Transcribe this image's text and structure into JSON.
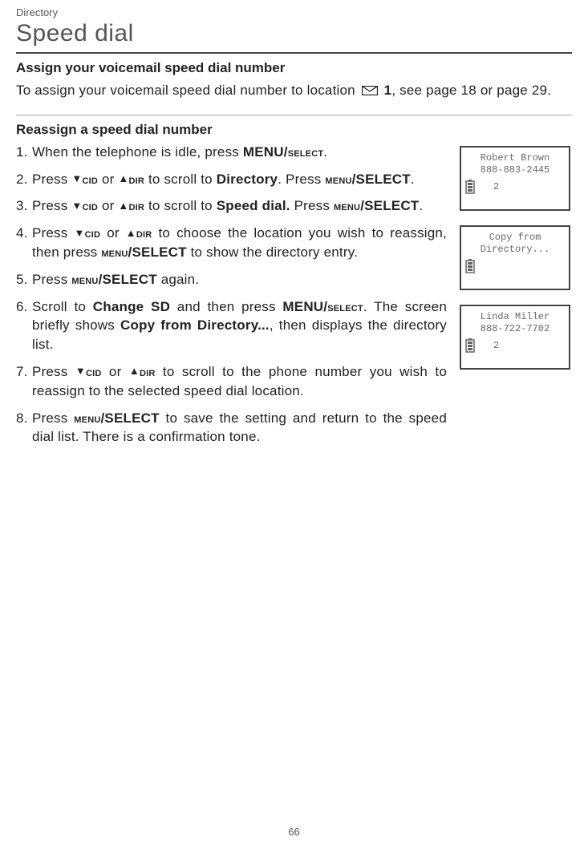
{
  "breadcrumb": "Directory",
  "page_title": "Speed dial",
  "section1": {
    "heading": "Assign your voicemail speed dial number",
    "text_a": "To assign your voicemail speed dial number to location ",
    "text_b": " 1",
    "text_c": ", see page 18 or page 29."
  },
  "section2": {
    "heading": "Reassign a speed dial number",
    "steps": [
      {
        "p": [
          {
            "t": "When the telephone is idle, press "
          },
          {
            "t": "MENU/",
            "b": true
          },
          {
            "t": "select",
            "sc": true,
            "b": true
          },
          {
            "t": "."
          }
        ]
      },
      {
        "p": [
          {
            "t": "Press "
          },
          {
            "t": "▼",
            "tri": true
          },
          {
            "t": "cid",
            "sc": true,
            "b": true
          },
          {
            "t": " or "
          },
          {
            "t": "▲",
            "tri": true
          },
          {
            "t": "dir",
            "sc": true,
            "b": true
          },
          {
            "t": " to scroll to "
          },
          {
            "t": "Directory",
            "b": true
          },
          {
            "t": ". Press "
          },
          {
            "t": "menu",
            "sc": true,
            "b": true
          },
          {
            "t": "/SELECT",
            "b": true
          },
          {
            "t": "."
          }
        ]
      },
      {
        "p": [
          {
            "t": "Press "
          },
          {
            "t": "▼",
            "tri": true
          },
          {
            "t": "cid",
            "sc": true,
            "b": true
          },
          {
            "t": " or "
          },
          {
            "t": "▲",
            "tri": true
          },
          {
            "t": "dir",
            "sc": true,
            "b": true
          },
          {
            "t": " to scroll to "
          },
          {
            "t": "Speed dial.",
            "b": true
          },
          {
            "t": " Press "
          },
          {
            "t": "menu",
            "sc": true,
            "b": true
          },
          {
            "t": "/SELECT",
            "b": true
          },
          {
            "t": "."
          }
        ]
      },
      {
        "p": [
          {
            "t": "Press "
          },
          {
            "t": "▼",
            "tri": true
          },
          {
            "t": "cid",
            "sc": true,
            "b": true
          },
          {
            "t": " or "
          },
          {
            "t": "▲",
            "tri": true
          },
          {
            "t": "dir",
            "sc": true,
            "b": true
          },
          {
            "t": " to choose the location you wish to reassign, then press "
          },
          {
            "t": "menu",
            "sc": true,
            "b": true
          },
          {
            "t": "/SELECT",
            "b": true
          },
          {
            "t": " to show the directory entry."
          }
        ]
      },
      {
        "p": [
          {
            "t": "Press "
          },
          {
            "t": "menu",
            "sc": true,
            "b": true
          },
          {
            "t": "/SELECT",
            "b": true
          },
          {
            "t": " again."
          }
        ]
      },
      {
        "p": [
          {
            "t": "Scroll to "
          },
          {
            "t": "Change SD",
            "b": true
          },
          {
            "t": " and then press "
          },
          {
            "t": "MENU/",
            "b": true
          },
          {
            "t": "select",
            "sc": true,
            "b": true
          },
          {
            "t": ". The screen briefly shows "
          },
          {
            "t": "Copy from Directory...",
            "b": true
          },
          {
            "t": ", then displays the directory list."
          }
        ]
      },
      {
        "p": [
          {
            "t": "Press "
          },
          {
            "t": "▼",
            "tri": true
          },
          {
            "t": "cid",
            "sc": true,
            "b": true
          },
          {
            "t": " or "
          },
          {
            "t": "▲",
            "tri": true
          },
          {
            "t": "dir",
            "sc": true,
            "b": true
          },
          {
            "t": " to scroll to the phone number you wish to reassign to the selected speed dial location."
          }
        ]
      },
      {
        "p": [
          {
            "t": "Press "
          },
          {
            "t": "menu",
            "sc": true,
            "b": true
          },
          {
            "t": "/SELECT",
            "b": true
          },
          {
            "t": " to save the setting and return to the speed dial list. There is a confirmation tone."
          }
        ]
      }
    ]
  },
  "screens": [
    {
      "line1": "Robert Brown",
      "line2": "888-883-2445",
      "sd": "2"
    },
    {
      "line1": "Copy from",
      "line2": "Directory...",
      "sd": ""
    },
    {
      "line1": "Linda Miller",
      "line2": "888-722-7702",
      "sd": "2"
    }
  ],
  "page_number": "66"
}
